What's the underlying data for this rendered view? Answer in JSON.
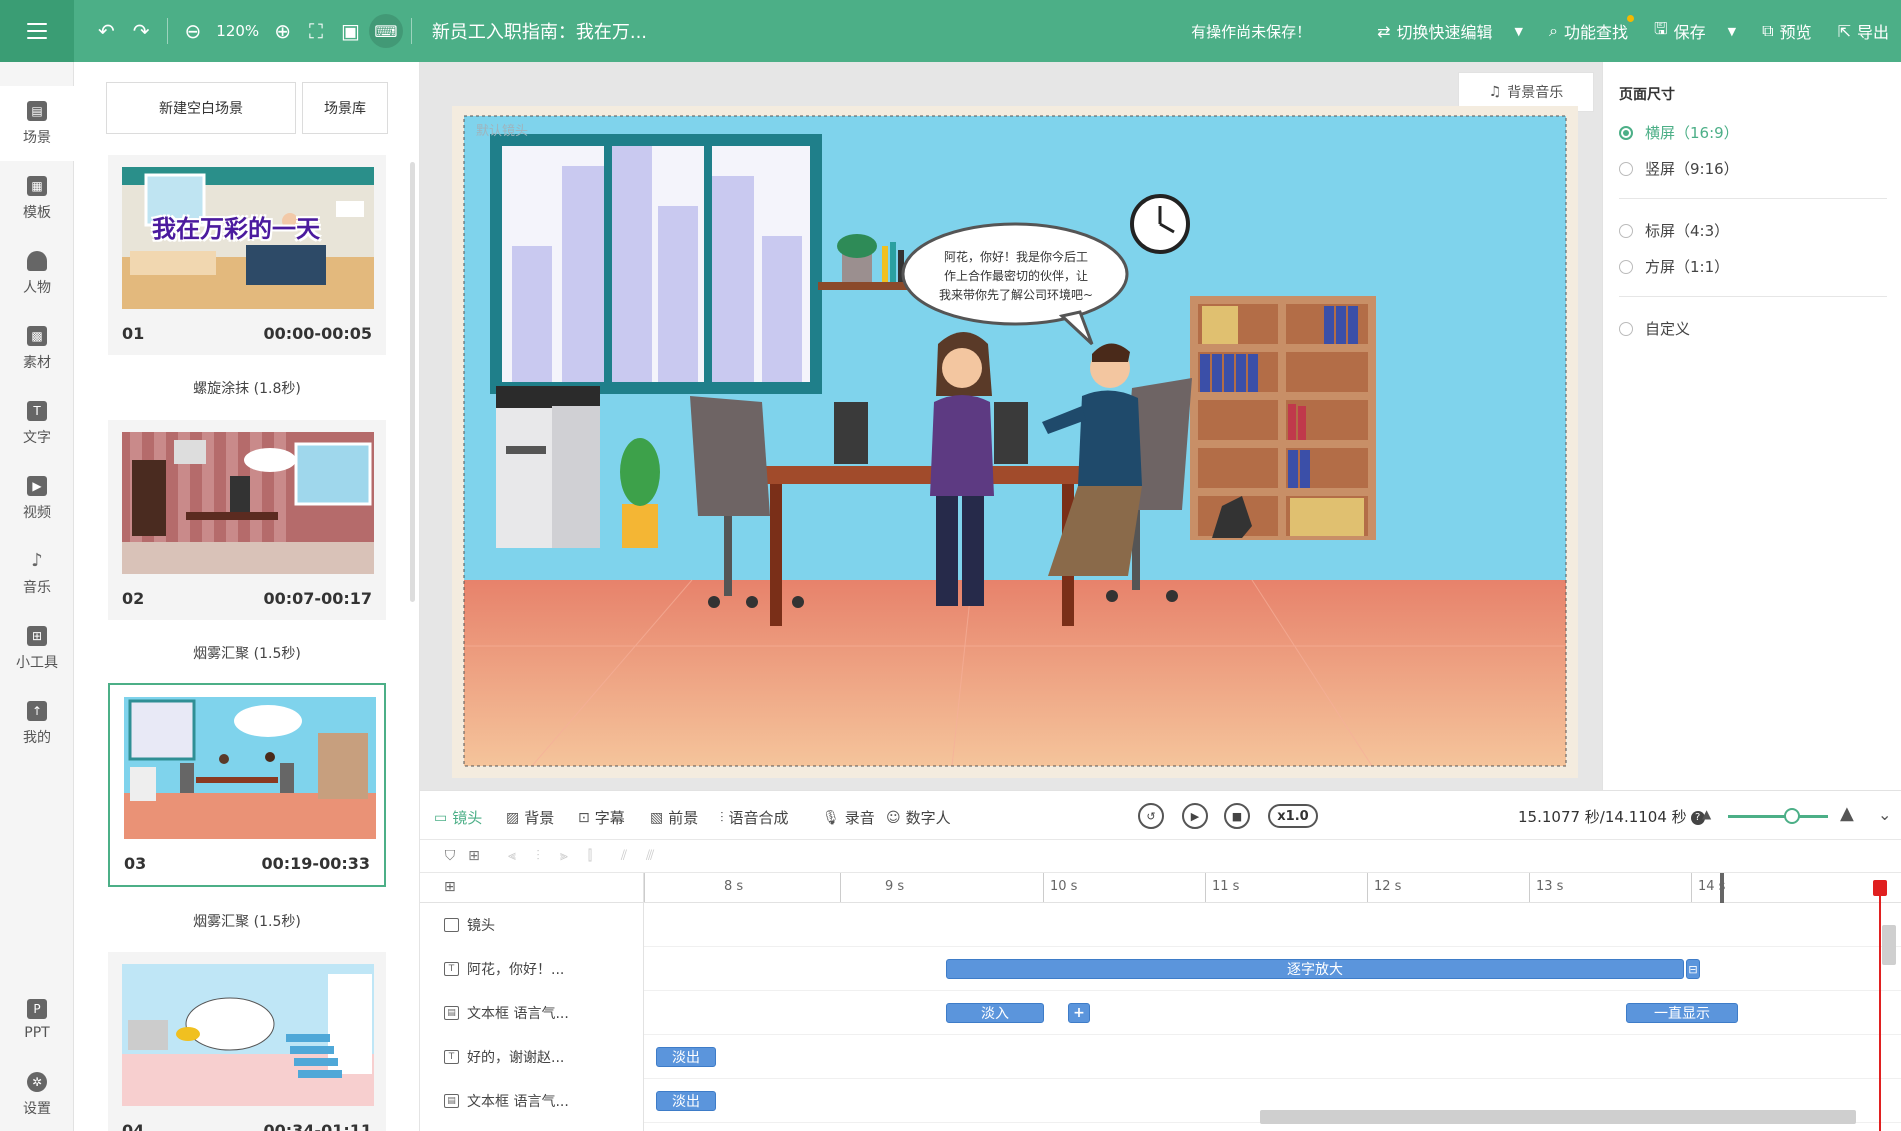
{
  "topbar": {
    "zoom": "120%",
    "doc_title": "新员工入职指南：我在万...",
    "unsaved": "有操作尚未保存！",
    "quick_edit": "切换快速编辑",
    "feature_search": "功能查找",
    "save": "保存",
    "preview": "预览",
    "export": "导出"
  },
  "leftnav": {
    "items": [
      {
        "label": "场景",
        "icon": "scene-icon"
      },
      {
        "label": "模板",
        "icon": "template-icon"
      },
      {
        "label": "人物",
        "icon": "person-icon"
      },
      {
        "label": "素材",
        "icon": "material-icon"
      },
      {
        "label": "文字",
        "icon": "text-icon"
      },
      {
        "label": "视频",
        "icon": "video-icon"
      },
      {
        "label": "音乐",
        "icon": "music-icon"
      },
      {
        "label": "小工具",
        "icon": "toolbox-icon"
      },
      {
        "label": "我的",
        "icon": "upload-icon"
      }
    ],
    "bottom": [
      {
        "label": "PPT",
        "icon": "ppt-icon"
      },
      {
        "label": "设置",
        "icon": "gear-icon"
      }
    ]
  },
  "scenes": {
    "new_blank": "新建空白场景",
    "library": "场景库",
    "items": [
      {
        "num": "01",
        "time": "00:00-00:05",
        "thumb_text": "我在万彩的一天",
        "transition": "螺旋涂抹 (1.8秒)"
      },
      {
        "num": "02",
        "time": "00:07-00:17",
        "transition": "烟雾汇聚 (1.5秒)"
      },
      {
        "num": "03",
        "time": "00:19-00:33",
        "transition": "烟雾汇聚 (1.5秒)"
      },
      {
        "num": "04",
        "time": "00:34-01:11"
      }
    ]
  },
  "canvas": {
    "bgm": "背景音乐",
    "lens_label": "默认镜头",
    "speech": [
      "阿花，你好！我是你今后工",
      "作上合作最密切的伙伴，让",
      "我来带你先了解公司环境吧~"
    ]
  },
  "page_size": {
    "title": "页面尺寸",
    "options": [
      {
        "label": "横屏（16:9）",
        "checked": true
      },
      {
        "label": "竖屏（9:16）",
        "checked": false
      },
      {
        "label": "标屏（4:3）",
        "checked": false
      },
      {
        "label": "方屏（1:1）",
        "checked": false
      },
      {
        "label": "自定义",
        "checked": false
      }
    ]
  },
  "timeline_toolbar": {
    "tabs": [
      "镜头",
      "背景",
      "字幕",
      "前景",
      "语音合成",
      "录音",
      "数字人"
    ],
    "speed": "x1.0",
    "time": "15.1077 秒/14.1104 秒"
  },
  "timeline": {
    "ruler": [
      "8 s",
      "9 s",
      "10 s",
      "11 s",
      "12 s",
      "13 s",
      "14 s"
    ],
    "tracks": [
      {
        "label": "镜头",
        "icon": "camera-icon"
      },
      {
        "label": "阿花，你好！...",
        "icon": "text-icon"
      },
      {
        "label": "文本框 语言气...",
        "icon": "textbox-icon"
      },
      {
        "label": "好的，谢谢赵...",
        "icon": "text-icon"
      },
      {
        "label": "文本框 语言气...",
        "icon": "textbox-icon"
      }
    ],
    "clips": {
      "track2_main": "逐字放大",
      "track3_in": "淡入",
      "track3_add": "+",
      "track3_always": "一直显示",
      "track4_out": "淡出",
      "track5_out": "淡出"
    }
  },
  "colors": {
    "accent": "#4caf87",
    "clip": "#5b95dc",
    "playhead": "#e02020"
  }
}
